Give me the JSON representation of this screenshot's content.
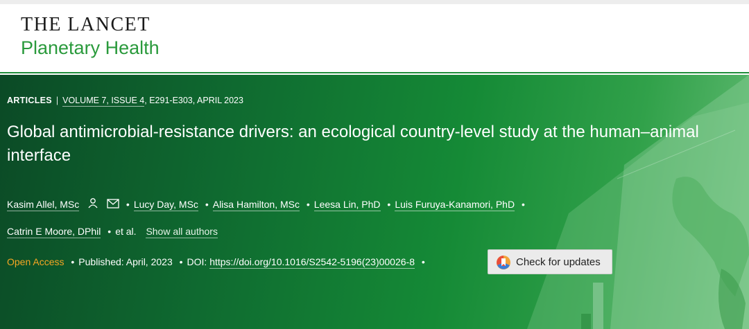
{
  "header": {
    "logo_line1": "THE LANCET",
    "logo_line2": "Planetary Health"
  },
  "article": {
    "type": "ARTICLES",
    "volume": "VOLUME 7, ISSUE 4",
    "pages_date": ", E291-E303, APRIL 2023",
    "title": "Global antimicrobial-resistance drivers: an ecological country-level study at the human–animal interface",
    "authors": [
      "Kasim Allel, MSc",
      "Lucy Day, MSc",
      "Alisa Hamilton, MSc",
      "Leesa Lin, PhD",
      "Luis Furuya-Kanamori, PhD",
      "Catrin E Moore, DPhil"
    ],
    "et_al": "et al.",
    "show_all": "Show all authors",
    "open_access": "Open Access",
    "published": "Published:  April, 2023",
    "doi_label": "DOI: ",
    "doi_link": "https://doi.org/10.1016/S2542-5196(23)00026-8",
    "check_updates": "Check for updates"
  },
  "colors": {
    "brand_green": "#2a9a3c",
    "open_access_orange": "#f5a623",
    "banner_dark": "#0b4a26",
    "banner_light": "#62bb73"
  },
  "icons": [
    "user-icon",
    "mail-icon",
    "check-updates-icon"
  ]
}
